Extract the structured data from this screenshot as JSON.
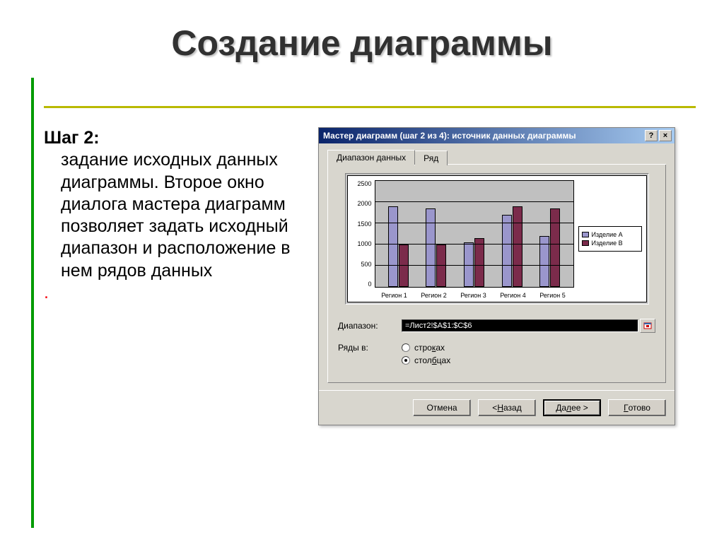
{
  "slide": {
    "title": "Создание диаграммы",
    "step_label": "Шаг 2:",
    "step_text": " задание исходных данных диаграммы. Второе окно диалога мастера диаграмм позволяет задать исходный диапазон и расположение в нем рядов данных",
    "trailing_dot": "."
  },
  "wizard": {
    "title": "Мастер диаграмм (шаг 2 из 4): источник данных диаграммы",
    "help_label": "?",
    "close_label": "×",
    "tabs": {
      "range": "Диапазон данных",
      "series": "Ряд"
    },
    "range_field_label": "Диапазон:",
    "range_value": "=Лист2!$A$1:$C$6",
    "rows_label": "Ряды в:",
    "radio_rows": "строках",
    "radio_cols": "столбцах",
    "buttons": {
      "cancel": "Отмена",
      "back_pre": "< ",
      "back_u": "Н",
      "back_post": "азад",
      "next_pre": "Да",
      "next_u": "л",
      "next_post": "ее >",
      "finish_u": "Г",
      "finish_post": "отово"
    }
  },
  "chart_data": {
    "type": "bar",
    "categories": [
      "Регион 1",
      "Регион 2",
      "Регион 3",
      "Регион 4",
      "Регион 5"
    ],
    "series": [
      {
        "name": "Изделие A",
        "values": [
          1900,
          1850,
          1050,
          1700,
          1200
        ]
      },
      {
        "name": "Изделие B",
        "values": [
          1000,
          1000,
          1150,
          1900,
          1850
        ]
      }
    ],
    "ylim": [
      0,
      2500
    ],
    "ystep": 500,
    "ylabels": [
      "2500",
      "2000",
      "1500",
      "1000",
      "500",
      "0"
    ],
    "title": "",
    "xlabel": "",
    "ylabel": ""
  }
}
